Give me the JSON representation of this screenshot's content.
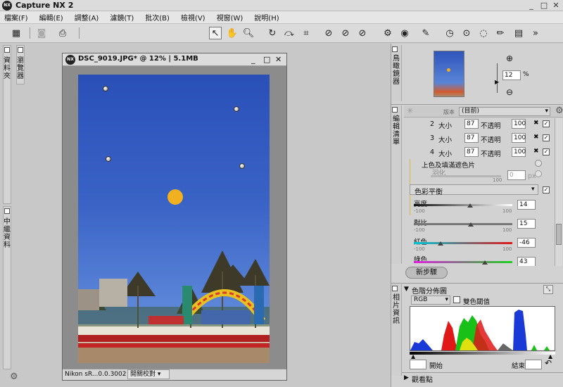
{
  "app": {
    "title": "Capture NX 2",
    "logo_text": "NX"
  },
  "window_controls": [
    "_",
    "□",
    "✕"
  ],
  "menu": [
    "檔案(F)",
    "編輯(E)",
    "調整(A)",
    "濾鏡(T)",
    "批次(B)",
    "檢視(V)",
    "視窗(W)",
    "說明(H)"
  ],
  "left_tabs": {
    "browser": "瀏覽器",
    "folders": "資料夾",
    "metadata": "中繼資料"
  },
  "document": {
    "title": "DSC_9019.JPG* @ 12% | 5.1MB",
    "logo_text": "NX",
    "status_profile": "Nikon sR...0.0.3002",
    "status_proof": "開關校對"
  },
  "birdseye": {
    "tab_label": "鳥瞰鏡器",
    "zoom_value": "12",
    "zoom_unit": "%"
  },
  "edit_list": {
    "tab_label": "編輯清單",
    "version_label": "版本",
    "version_value": "(目前)",
    "selection_rows": [
      {
        "index": "2",
        "size_label": "大小",
        "size": "87",
        "opacity_label": "不透明",
        "opacity": "100"
      },
      {
        "index": "3",
        "size_label": "大小",
        "size": "87",
        "opacity_label": "不透明",
        "opacity": "100"
      },
      {
        "index": "4",
        "size_label": "大小",
        "size": "87",
        "opacity_label": "不透明",
        "opacity": "100"
      }
    ],
    "fill_label": "上色及填滿遮色片",
    "feather_label": "羽化",
    "feather_value": "0",
    "feather_unit": "px",
    "feather_max": "100",
    "step_name": "色彩平衡",
    "sliders": [
      {
        "label": "亮度",
        "min": "-100",
        "max": "100",
        "value": "14",
        "pos": 0.57
      },
      {
        "label": "對比",
        "min": "-100",
        "max": "100",
        "value": "15",
        "pos": 0.575
      },
      {
        "label": "紅色",
        "min": "-100",
        "max": "100",
        "value": "-46",
        "pos": 0.27
      },
      {
        "label": "綠色",
        "min": "-100",
        "max": "100",
        "value": "43",
        "pos": 0.72
      }
    ],
    "new_step_button": "新步驟"
  },
  "photo_info": {
    "tab_label": "相片資訊",
    "section_title": "色階分佈圖",
    "channel": "RGB",
    "dual_threshold": "雙色閾值",
    "start_label": "開始",
    "end_label": "結束",
    "next_section": "觀看點"
  },
  "colors": {
    "accent_selected": "#f2f2f2",
    "sky": "#3a63c6",
    "balloon": "#f0b020"
  }
}
